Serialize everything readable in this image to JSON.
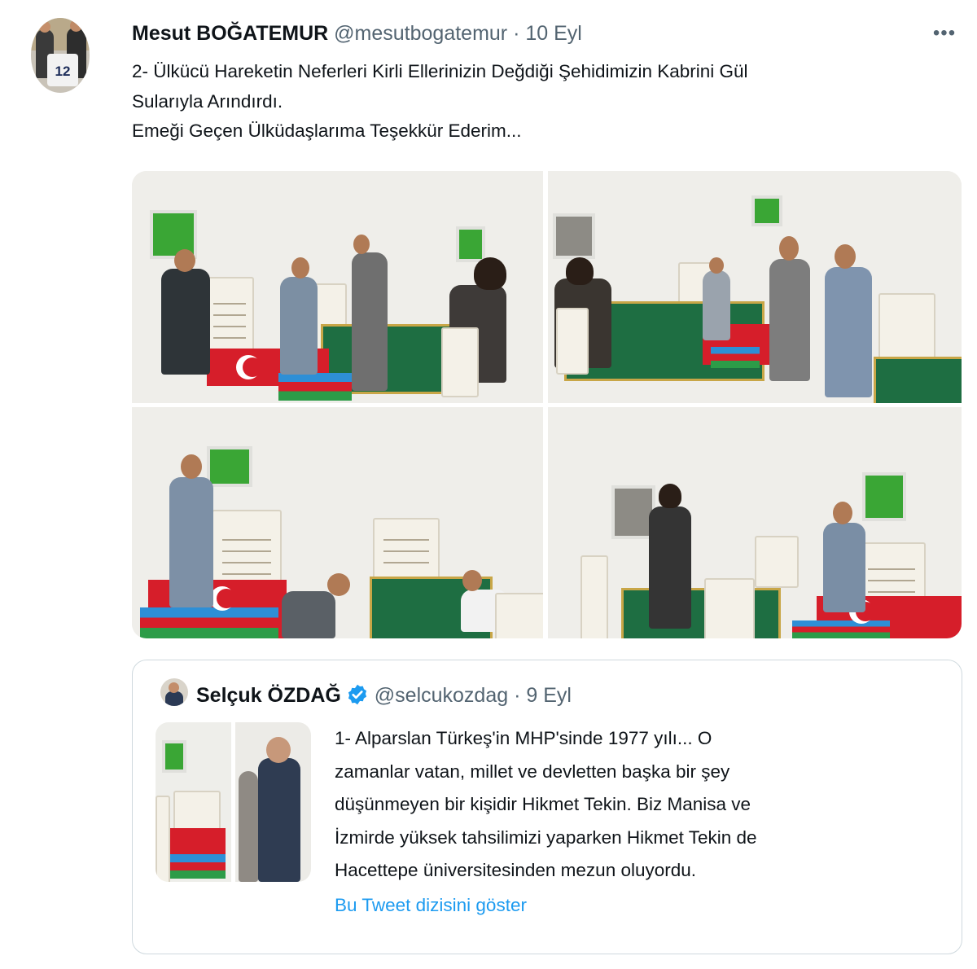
{
  "tweet": {
    "author_name": "Mesut BOĞATEMUR",
    "handle": "@mesutbogatemur",
    "separator": "·",
    "date": "10 Eyl",
    "avatar_jersey": "12",
    "more_label": "•••",
    "text_lines": [
      "2- Ülkücü Hareketin Neferleri Kirli Ellerinizin Değdiği Şehidimizin Kabrini Gül",
      "Sularıyla Arındırdı.",
      "Emeği Geçen Ülküdaşlarıma Teşekkür Ederim..."
    ],
    "photo_count": 4
  },
  "quoted_tweet": {
    "author_name": "Selçuk ÖZDAĞ",
    "handle": "@selcukozdag",
    "separator": "·",
    "date": "9 Eyl",
    "verified": true,
    "text_lines": [
      "1- Alparslan Türkeş'in MHP'sinde 1977 yılı... O",
      "zamanlar vatan, millet ve devletten başka bir şey",
      "düşünmeyen bir kişidir Hikmet Tekin. Biz Manisa ve",
      "İzmirde yüksek tahsilimizi yaparken Hikmet Tekin de",
      "Hacettepe üniversitesinden mezun oluyordu."
    ],
    "thread_link": "Bu Tweet dizisini göster",
    "photo_count": 2
  },
  "colors": {
    "text": "#0f1419",
    "secondary": "#536471",
    "link": "#1d9bf0",
    "border": "#cfd9de",
    "verified": "#1d9bf0"
  }
}
